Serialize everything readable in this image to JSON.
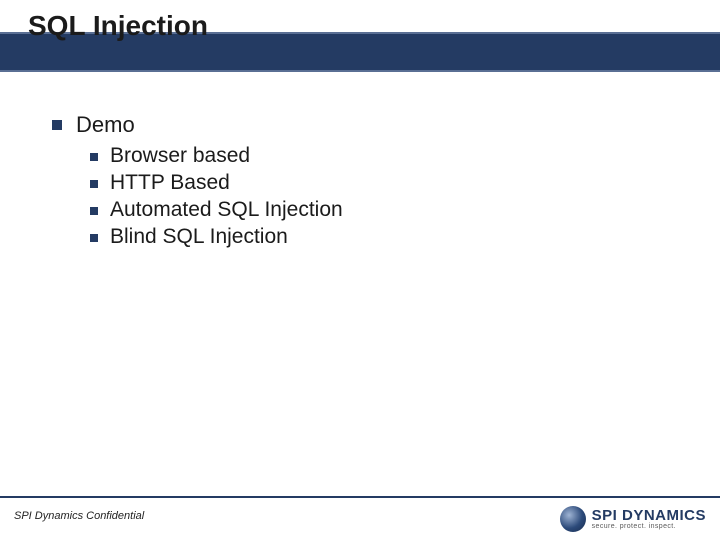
{
  "slide": {
    "title": "SQL Injection",
    "bullets": [
      {
        "text": "Demo",
        "children": [
          "Browser based",
          "HTTP Based",
          "Automated SQL Injection",
          "Blind SQL Injection"
        ]
      }
    ]
  },
  "footer": {
    "confidential": "SPI Dynamics Confidential",
    "logo": {
      "name": "SPI DYNAMICS",
      "tagline": "secure. protect. inspect."
    }
  }
}
